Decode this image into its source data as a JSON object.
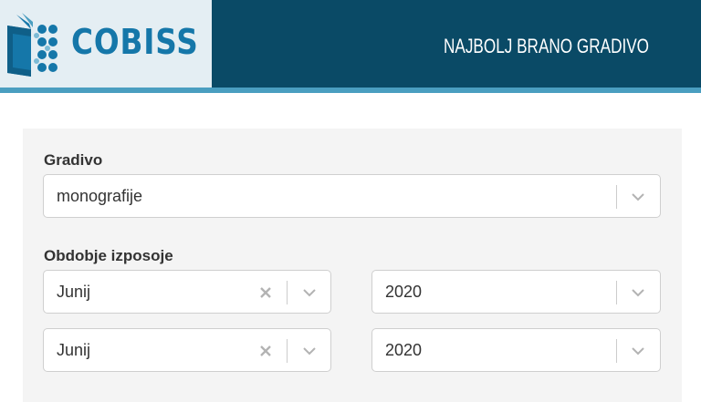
{
  "header": {
    "logo_text": "COBISS",
    "title": "NAJBOLJ BRANO GRADIVO"
  },
  "colors": {
    "brand_dark": "#0a4a66",
    "brand_accent": "#4a9ec0",
    "logo_blue": "#1577a9"
  },
  "form": {
    "gradivo_label": "Gradivo",
    "gradivo_value": "monografije",
    "period_label": "Obdobje izposoje",
    "from_month": "Junij",
    "from_year": "2020",
    "to_month": "Junij",
    "to_year": "2020"
  },
  "icons": {
    "logo": "book-icon",
    "dropdown": "chevron-down-icon",
    "clear": "close-icon"
  }
}
